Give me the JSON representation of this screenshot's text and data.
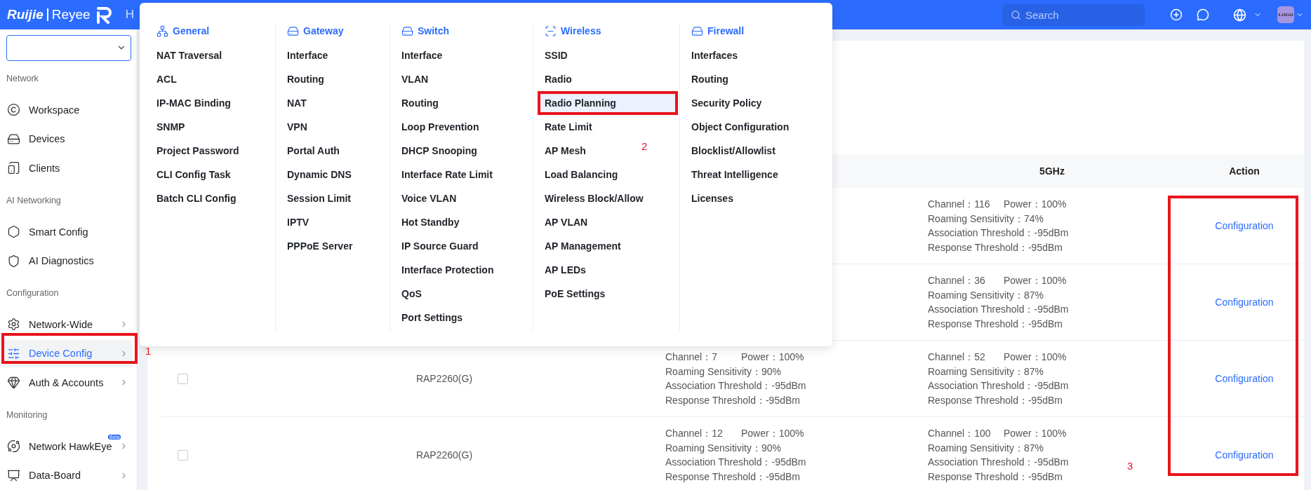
{
  "header": {
    "logo": [
      "Ruijie",
      "Reyee"
    ],
    "nav_fragment": "H",
    "search": {
      "placeholder": "Search"
    },
    "avatar": "LOGO"
  },
  "sidebar": {
    "sections": [
      {
        "title": "Network",
        "items": [
          {
            "label": "Workspace",
            "expandable": false,
            "selected": false
          },
          {
            "label": "Devices",
            "expandable": false,
            "selected": false
          },
          {
            "label": "Clients",
            "expandable": false,
            "selected": false
          }
        ]
      },
      {
        "title": "AI Networking",
        "items": [
          {
            "label": "Smart Config",
            "expandable": false,
            "selected": false
          },
          {
            "label": "AI Diagnostics",
            "expandable": false,
            "selected": false
          }
        ]
      },
      {
        "title": "Configuration",
        "items": [
          {
            "label": "Network-Wide",
            "expandable": true,
            "selected": false
          },
          {
            "label": "Device Config",
            "expandable": true,
            "selected": true
          },
          {
            "label": "Auth & Accounts",
            "expandable": true,
            "selected": false
          }
        ]
      },
      {
        "title": "Monitoring",
        "items": [
          {
            "label": "Network HawkEye",
            "expandable": true,
            "selected": false,
            "badge": "Beta"
          },
          {
            "label": "Data-Board",
            "expandable": true,
            "selected": false
          }
        ]
      }
    ]
  },
  "menu": {
    "columns": [
      {
        "title": "General",
        "items": [
          {
            "label": "NAT Traversal",
            "selected": false
          },
          {
            "label": "ACL",
            "selected": false
          },
          {
            "label": "IP-MAC Binding",
            "selected": false
          },
          {
            "label": "SNMP",
            "selected": false
          },
          {
            "label": "Project Password",
            "selected": false
          },
          {
            "label": "CLI Config Task",
            "selected": false
          },
          {
            "label": "Batch CLI Config",
            "selected": false
          }
        ]
      },
      {
        "title": "Gateway",
        "items": [
          {
            "label": "Interface",
            "selected": false
          },
          {
            "label": "Routing",
            "selected": false
          },
          {
            "label": "NAT",
            "selected": false
          },
          {
            "label": "VPN",
            "selected": false
          },
          {
            "label": "Portal Auth",
            "selected": false
          },
          {
            "label": "Dynamic DNS",
            "selected": false
          },
          {
            "label": "Session Limit",
            "selected": false
          },
          {
            "label": "IPTV",
            "selected": false
          },
          {
            "label": "PPPoE Server",
            "selected": false
          }
        ]
      },
      {
        "title": "Switch",
        "items": [
          {
            "label": "Interface",
            "selected": false
          },
          {
            "label": "VLAN",
            "selected": false
          },
          {
            "label": "Routing",
            "selected": false
          },
          {
            "label": "Loop Prevention",
            "selected": false
          },
          {
            "label": "DHCP Snooping",
            "selected": false
          },
          {
            "label": "Interface Rate Limit",
            "selected": false
          },
          {
            "label": "Voice VLAN",
            "selected": false
          },
          {
            "label": "Hot Standby",
            "selected": false
          },
          {
            "label": "IP Source Guard",
            "selected": false
          },
          {
            "label": "Interface Protection",
            "selected": false
          },
          {
            "label": "QoS",
            "selected": false
          },
          {
            "label": "Port Settings",
            "selected": false
          }
        ]
      },
      {
        "title": "Wireless",
        "items": [
          {
            "label": "SSID",
            "selected": false
          },
          {
            "label": "Radio",
            "selected": false
          },
          {
            "label": "Radio Planning",
            "selected": true
          },
          {
            "label": "Rate Limit",
            "selected": false
          },
          {
            "label": "AP Mesh",
            "selected": false
          },
          {
            "label": "Load Balancing",
            "selected": false
          },
          {
            "label": "Wireless Block/Allow",
            "selected": false
          },
          {
            "label": "AP VLAN",
            "selected": false
          },
          {
            "label": "AP Management",
            "selected": false
          },
          {
            "label": "AP LEDs",
            "selected": false
          },
          {
            "label": "PoE Settings",
            "selected": false
          }
        ]
      },
      {
        "title": "Firewall",
        "items": [
          {
            "label": "Interfaces",
            "selected": false
          },
          {
            "label": "Routing",
            "selected": false
          },
          {
            "label": "Security Policy",
            "selected": false
          },
          {
            "label": "Object Configuration",
            "selected": false
          },
          {
            "label": "Blocklist/Allowlist",
            "selected": false
          },
          {
            "label": "Threat Intelligence",
            "selected": false
          },
          {
            "label": "Licenses",
            "selected": false
          }
        ]
      }
    ]
  },
  "table": {
    "headers": {
      "band_5": "5GHz",
      "action": "Action"
    },
    "rows": [
      {
        "band_5": [
          [
            "Channel：116",
            "Power：100%"
          ],
          [
            "Roaming Sensitivity：74%"
          ],
          [
            "Association Threshold：-95dBm"
          ],
          [
            "Response Threshold：-95dBm"
          ]
        ],
        "action": "Configuration"
      },
      {
        "band_5": [
          [
            "Channel：36",
            "Power：100%"
          ],
          [
            "Roaming Sensitivity：87%"
          ],
          [
            "Association Threshold：-95dBm"
          ],
          [
            "Response Threshold：-95dBm"
          ]
        ],
        "action": "Configuration"
      },
      {
        "checked": false,
        "model": "RAP2260(G)",
        "band_24": [
          [
            "Channel：7",
            "Power：100%"
          ],
          [
            "Roaming Sensitivity：90%"
          ],
          [
            "Association Threshold：-95dBm"
          ],
          [
            "Response Threshold：-95dBm"
          ]
        ],
        "band_5": [
          [
            "Channel：52",
            "Power：100%"
          ],
          [
            "Roaming Sensitivity：87%"
          ],
          [
            "Association Threshold：-95dBm"
          ],
          [
            "Response Threshold：-95dBm"
          ]
        ],
        "action": "Configuration"
      },
      {
        "checked": false,
        "model": "RAP2260(G)",
        "band_24": [
          [
            "Channel：12",
            "Power：100%"
          ],
          [
            "Roaming Sensitivity：90%"
          ],
          [
            "Association Threshold：-95dBm"
          ],
          [
            "Response Threshold：-95dBm"
          ]
        ],
        "band_5": [
          [
            "Channel：100",
            "Power：100%"
          ],
          [
            "Roaming Sensitivity：87%"
          ],
          [
            "Association Threshold：-95dBm"
          ],
          [
            "Response Threshold：-95dBm"
          ]
        ],
        "action": "Configuration"
      }
    ]
  },
  "annotations": [
    {
      "label": "1"
    },
    {
      "label": "2"
    },
    {
      "label": "3"
    }
  ]
}
